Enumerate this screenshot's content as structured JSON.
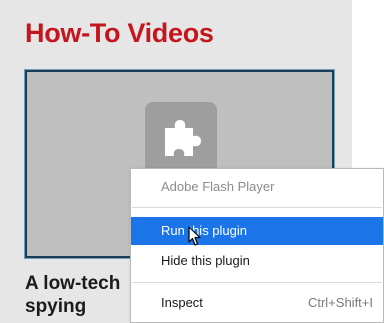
{
  "section": {
    "title": "How-To Videos"
  },
  "article": {
    "title": "A low-tech spying"
  },
  "context_menu": {
    "header": "Adobe Flash Player",
    "items": [
      {
        "label": "Run this plugin"
      },
      {
        "label": "Hide this plugin"
      },
      {
        "label": "Inspect",
        "shortcut": "Ctrl+Shift+I"
      }
    ]
  },
  "colors": {
    "title_red": "#c4161c",
    "highlight_blue": "#1b74e8",
    "panel_bg": "#e6e6e6",
    "video_bg": "#bfbfbf"
  },
  "icons": {
    "plugin": "puzzle-piece-icon",
    "cursor": "mouse-pointer-icon"
  }
}
